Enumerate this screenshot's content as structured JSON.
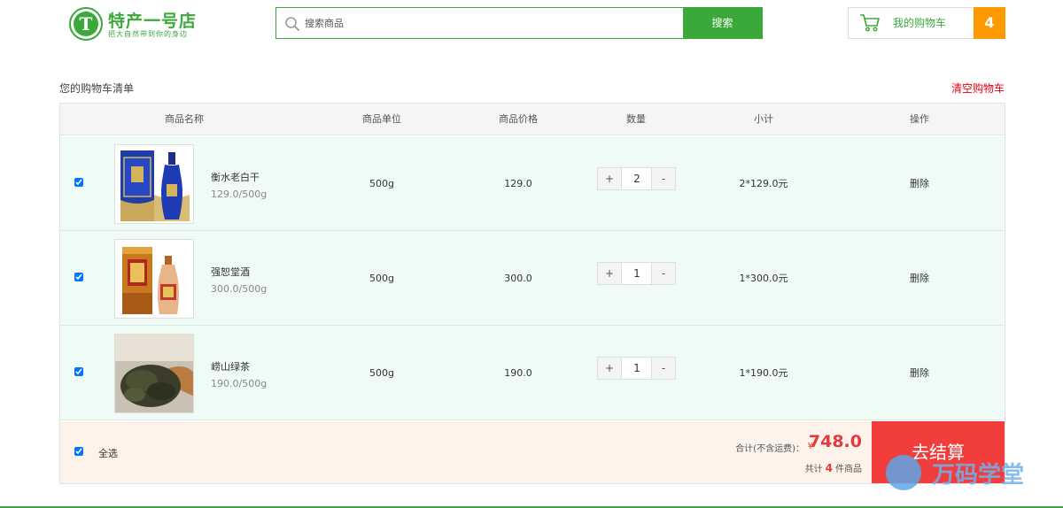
{
  "header": {
    "logo_letter": "T",
    "logo_title": "特产一号店",
    "logo_slogan": "把大自然带到你的身边",
    "search_placeholder": "搜索商品",
    "search_button": "搜索",
    "cart_label": "我的购物车",
    "cart_count": "4"
  },
  "cart": {
    "list_title": "您的购物车清单",
    "clear_label": "清空购物车",
    "columns": [
      "商品名称",
      "商品单位",
      "商品价格",
      "数量",
      "小计",
      "操作"
    ],
    "items": [
      {
        "name": "衡水老白干",
        "unit_price_text": "129.0/500g",
        "unit": "500g",
        "price": "129.0",
        "qty": "2",
        "subtotal": "2*129.0元",
        "action": "删除",
        "thumb_icon": "blue-liquor-bottle-image"
      },
      {
        "name": "强恕堂酒",
        "unit_price_text": "300.0/500g",
        "unit": "500g",
        "price": "300.0",
        "qty": "1",
        "subtotal": "1*300.0元",
        "action": "删除",
        "thumb_icon": "gold-liquor-bottle-image"
      },
      {
        "name": "崂山绿茶",
        "unit_price_text": "190.0/500g",
        "unit": "500g",
        "price": "190.0",
        "qty": "1",
        "subtotal": "1*190.0元",
        "action": "删除",
        "thumb_icon": "green-tea-leaves-image"
      }
    ],
    "plus": "+",
    "minus": "-",
    "footer": {
      "select_all": "全选",
      "total_label": "合计(不含运费)：",
      "currency": "¥",
      "total": "748.0",
      "count_prefix": "共计",
      "count": "4",
      "count_suffix": "件商品",
      "checkout": "去结算"
    }
  },
  "watermark": {
    "text": "万码学堂",
    "icon": "watermark-logo-icon"
  },
  "colors": {
    "brand_green": "#3aa93a",
    "badge_orange": "#ff9900",
    "danger_red": "#e4393c",
    "checkout_red": "#f23d3d",
    "row_bg": "#effcf5",
    "footer_bg": "#fdf3eb"
  }
}
